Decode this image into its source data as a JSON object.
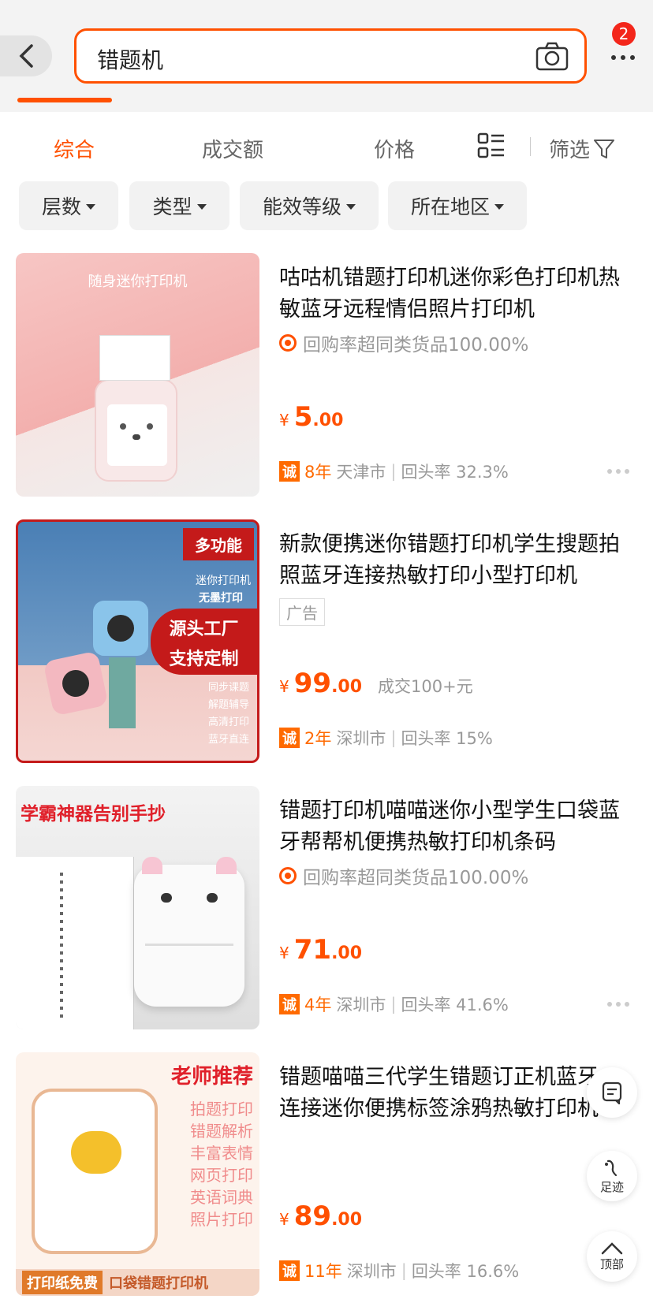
{
  "header": {
    "back_label": "back",
    "search_query": "错题机",
    "notification_count": "2"
  },
  "sort_bar": {
    "tabs": [
      "综合",
      "成交额",
      "价格"
    ],
    "filter_label": "筛选"
  },
  "filter_chips": [
    "层数",
    "类型",
    "能效等级",
    "所在地区"
  ],
  "products": [
    {
      "title": "咕咕机错题打印机迷你彩色打印机热敏蓝牙远程情侣照片打印机",
      "tagline": "回购率超同类货品100.00%",
      "price_int": "5",
      "price_dec": ".00",
      "currency": "¥",
      "years": "8年",
      "city": "天津市",
      "return_rate": "回头率 32.3%",
      "thumb_text": "随身迷你打印机"
    },
    {
      "title": "新款便携迷你错题打印机学生搜题拍照蓝牙连接热敏打印小型打印机",
      "ad_label": "广告",
      "price_int": "99",
      "price_dec": ".00",
      "currency": "¥",
      "sold": "成交100+元",
      "years": "2年",
      "city": "深圳市",
      "return_rate": "回头率 15%",
      "thumb_texts": [
        "多功能",
        "迷你打印机",
        "无墨打印",
        "源头工厂",
        "支持定制",
        "同步课题",
        "解题辅导",
        "高清打印",
        "蓝牙直连"
      ]
    },
    {
      "title": "错题打印机喵喵迷你小型学生口袋蓝牙帮帮机便携热敏打印机条码",
      "tagline": "回购率超同类货品100.00%",
      "price_int": "71",
      "price_dec": ".00",
      "currency": "¥",
      "years": "4年",
      "city": "深圳市",
      "return_rate": "回头率 41.6%",
      "thumb_text": "学霸神器告别手抄"
    },
    {
      "title": "错题喵喵三代学生错题订正机蓝牙连接迷你便携标签涂鸦热敏打印机",
      "price_int": "89",
      "price_dec": ".00",
      "currency": "¥",
      "years": "11年",
      "city": "深圳市",
      "return_rate": "回头率 16.6%",
      "thumb_texts": [
        "老师推荐",
        "拍题打印",
        "错题解析",
        "丰富表情",
        "网页打印",
        "英语词典",
        "照片打印",
        "打印纸免费",
        "口袋错题打印机"
      ]
    }
  ],
  "floating": {
    "history_label": "足迹",
    "top_label": "顶部"
  },
  "cheng_char": "诚",
  "colors": {
    "accent": "#ff5000",
    "price": "#ff5000"
  }
}
